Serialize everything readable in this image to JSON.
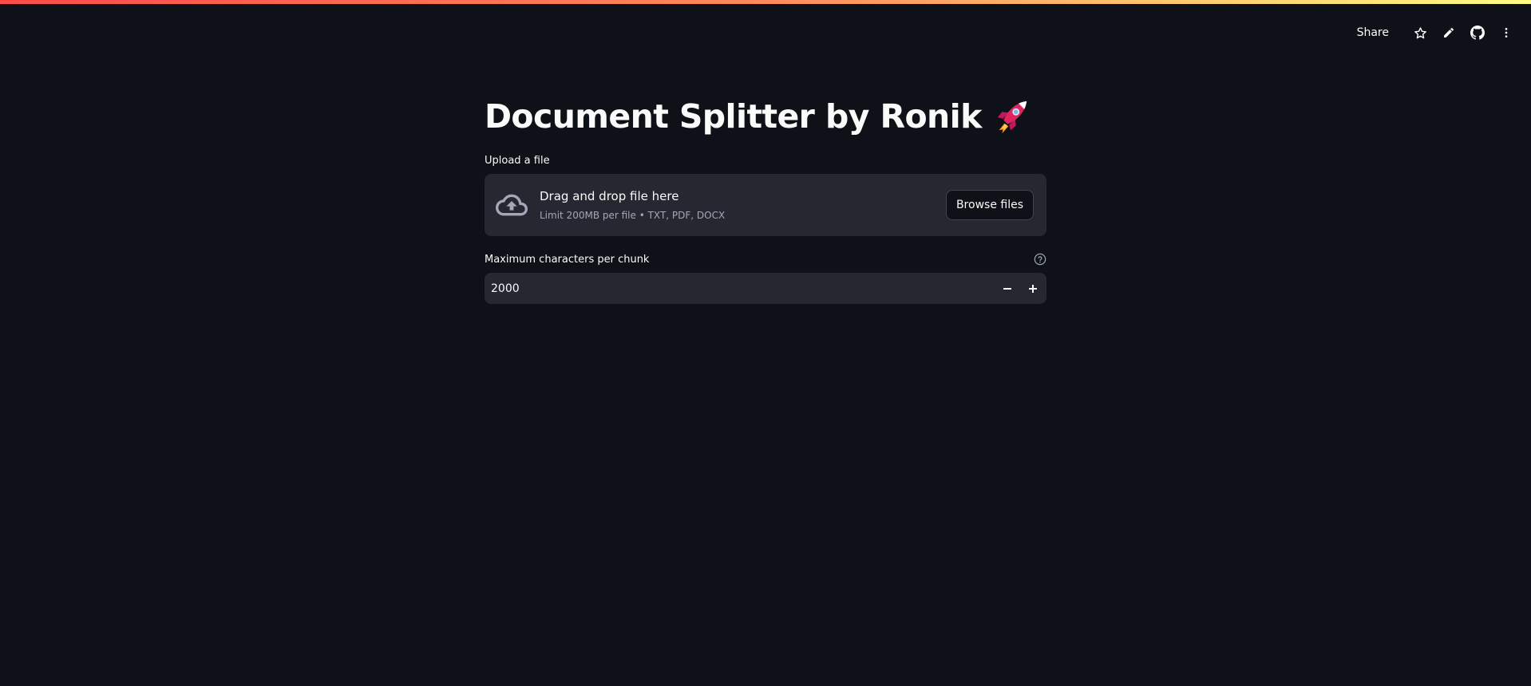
{
  "toolbar": {
    "share_label": "Share",
    "icons": [
      "star-icon",
      "pencil-icon",
      "github-icon",
      "more-vert-icon"
    ]
  },
  "page": {
    "title": "Document Splitter by Ronik",
    "title_emoji": "rocket-icon"
  },
  "uploader": {
    "label": "Upload a file",
    "dropzone_title": "Drag and drop file here",
    "dropzone_subtitle": "Limit 200MB per file • TXT, PDF, DOCX",
    "browse_label": "Browse files",
    "icon": "cloud-upload-icon"
  },
  "chunk_input": {
    "label": "Maximum characters per chunk",
    "value": "2000",
    "minus_symbol": "−",
    "plus_symbol": "+",
    "help_icon": "help-circle-icon"
  },
  "colors": {
    "background": "#0e1117",
    "surface": "#262730",
    "text": "#fafafa",
    "muted_text": "#a3a8b8",
    "accent_gradient_start": "#ff4b4b",
    "accent_gradient_end": "#fffd80"
  }
}
